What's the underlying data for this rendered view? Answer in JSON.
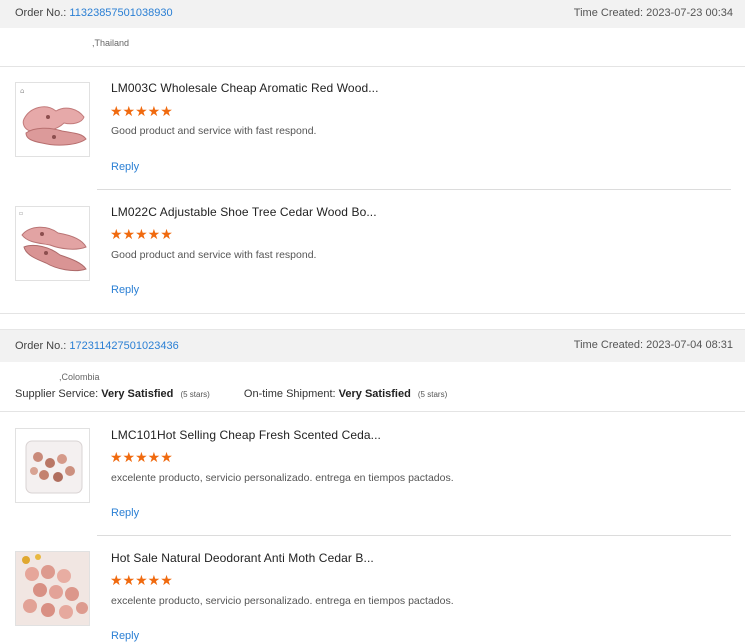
{
  "orders": [
    {
      "order_no_label": "Order No.:",
      "order_no": "11323857501038930",
      "time_created": "Time Created: 2023-07-23 00:34",
      "country": ",Thailand",
      "items": [
        {
          "title": "LM003C Wholesale Cheap Aromatic Red Wood...",
          "stars": "★★★★★",
          "comment": "Good product and service with fast respond.",
          "reply": "Reply"
        },
        {
          "title": "LM022C Adjustable Shoe Tree Cedar Wood Bo...",
          "stars": "★★★★★",
          "comment": "Good product and service with fast respond.",
          "reply": "Reply"
        }
      ]
    },
    {
      "order_no_label": "Order No.:",
      "order_no": "172311427501023436",
      "time_created": "Time Created: 2023-07-04 08:31",
      "country": ",Colombia",
      "supplier_service_label": "Supplier Service:",
      "supplier_service_value": "Very Satisfied",
      "supplier_service_stars": "(5 stars)",
      "shipment_label": "On-time Shipment:",
      "shipment_value": "Very Satisfied",
      "shipment_stars": "(5 stars)",
      "items": [
        {
          "title": "LMC101Hot Selling Cheap Fresh Scented Ceda...",
          "stars": "★★★★★",
          "comment": "excelente producto, servicio personalizado. entrega en tiempos pactados.",
          "reply": "Reply"
        },
        {
          "title": "Hot Sale Natural Deodorant Anti Moth Cedar B...",
          "stars": "★★★★★",
          "comment": "excelente producto, servicio personalizado. entrega en tiempos pactados.",
          "reply": "Reply"
        }
      ]
    }
  ],
  "colors": {
    "accent": "#2a7fd4",
    "star": "#f06a0f"
  }
}
